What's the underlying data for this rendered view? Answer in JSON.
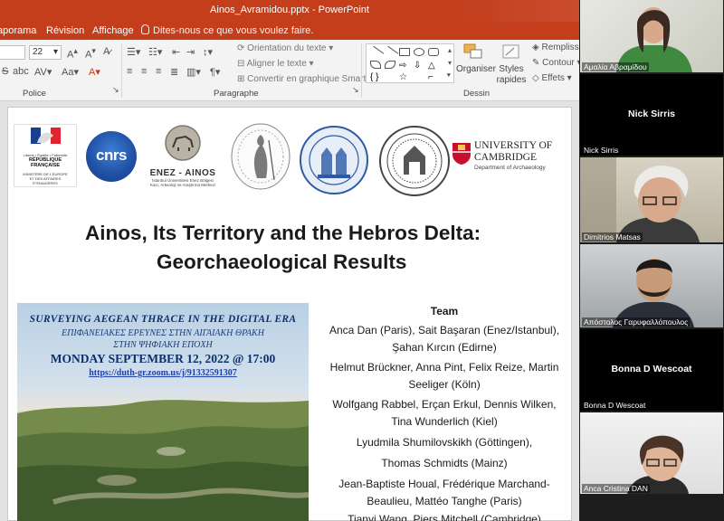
{
  "window": {
    "title": "Ainos_Avramidou.pptx - PowerPoint"
  },
  "tabs": [
    "aporama",
    "Révision",
    "Affichage"
  ],
  "tell_me": "Dites-nous ce que vous voulez faire.",
  "ribbon": {
    "font_size": "22",
    "groups": {
      "police": "Police",
      "paragraphe": "Paragraphe",
      "dessin": "Dessin"
    },
    "text_orientation": "Orientation du texte",
    "align_text": "Aligner le texte",
    "smartart": "Convertir en graphique SmartArt",
    "organiser": "Organiser",
    "styles_rapides": "Styles rapides",
    "remplissage": "Remplissage",
    "contour": "Contour",
    "effets": "Effets"
  },
  "slide": {
    "logos": {
      "france_line1": "Liberté • Égalité • Fraternité",
      "france_line2": "RÉPUBLIQUE FRANÇAISE",
      "france_ministry": "MINISTÈRE DE L'EUROPE ET DES AFFAIRES ÉTRANGÈRES",
      "cnrs": "cnrs",
      "enez_title": "ENEZ - AINOS",
      "enez_sub": "İstanbul Üniversitesi Enez Bölgesi Kazı, Arkeoloji ve Araştırma Merkezi",
      "cambridge_name": "UNIVERSITY OF CAMBRIDGE",
      "cambridge_dept": "Department of Archaeology"
    },
    "title_line1": "Ainos, Its Territory and the Hebros Delta:",
    "title_line2": "Georchaeological Results",
    "poster": {
      "line1": "Surveying Aegean Thrace in the Digital Era",
      "line2": "ΕΠΙΦΑΝΕΙΑΚΕΣ ΕΡΕΥΝΕΣ ΣΤΗΝ ΑΙΓΑΙΑΚΗ ΘΡΑΚΗ",
      "line3": "ΣΤΗΝ ΨΗΦΙΑΚΗ ΕΠΟΧΗ",
      "date": "Monday September 12, 2022 @ 17:00",
      "link": "https://duth-gr.zoom.us/j/91332591307"
    },
    "team": {
      "heading": "Team",
      "lines": [
        "Anca Dan (Paris), Sait Başaran (Enez/Istanbul),",
        "Şahan Kırcın (Edirne)",
        "Helmut Brückner, Anna Pint, Felix Reize, Martin",
        "Seeliger (Köln)",
        "Wolfgang Rabbel, Erçan Erkul, Dennis Wilken,",
        "Tina Wunderlich (Kiel)",
        "Lyudmila Shumilovskikh (Göttingen),",
        "Thomas Schmidts (Mainz)",
        "Jean-Baptiste Houal, Frédérique Marchand-",
        "Beaulieu, Mattéo Tanghe (Paris)",
        "Tianyi Wang, Piers Mitchell (Cambridge)"
      ]
    }
  },
  "participants": [
    {
      "name": "Αμαλία Αβραμίδου",
      "video": true
    },
    {
      "name": "Nick Sirris",
      "video": false
    },
    {
      "name": "Dimitrios Matsas",
      "video": true
    },
    {
      "name": "Απόστολος Γαρυφαλλόπουλος",
      "video": true
    },
    {
      "name": "Bonna D Wescoat",
      "video": false
    },
    {
      "name": "Anca Cristina DAN",
      "video": true
    }
  ],
  "colors": {
    "ppt_accent": "#c43e1c",
    "poster_title": "#0c2f6c"
  }
}
